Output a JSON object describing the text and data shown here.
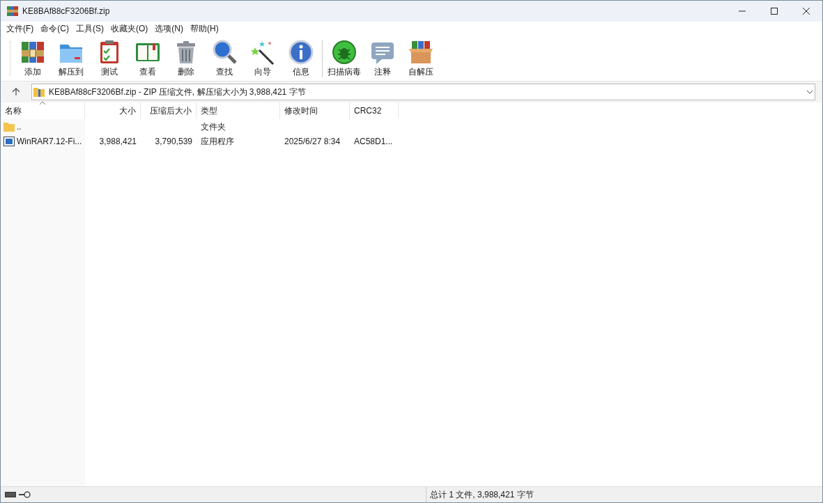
{
  "window": {
    "title": "KE8BAf88cF3206Bf.zip"
  },
  "menu": [
    "文件(F)",
    "命令(C)",
    "工具(S)",
    "收藏夹(O)",
    "选项(N)",
    "帮助(H)"
  ],
  "toolbar": [
    {
      "kind": "add",
      "label": "添加"
    },
    {
      "kind": "extract",
      "label": "解压到"
    },
    {
      "kind": "test",
      "label": "测试"
    },
    {
      "kind": "view",
      "label": "查看"
    },
    {
      "kind": "delete",
      "label": "删除"
    },
    {
      "kind": "find",
      "label": "查找"
    },
    {
      "kind": "wizard",
      "label": "向导"
    },
    {
      "kind": "info",
      "label": "信息"
    },
    {
      "kind": "separator"
    },
    {
      "kind": "scan",
      "label": "扫描病毒"
    },
    {
      "kind": "comment",
      "label": "注释"
    },
    {
      "kind": "sfx",
      "label": "自解压"
    }
  ],
  "path": "KE8BAf88cF3206Bf.zip - ZIP 压缩文件, 解压缩大小为 3,988,421 字节",
  "table": {
    "columns": [
      "名称",
      "大小",
      "压缩后大小",
      "类型",
      "修改时间",
      "CRC32"
    ],
    "rows": [
      {
        "kind": "folder",
        "cells": [
          "..",
          "",
          "",
          "文件夹",
          "",
          ""
        ]
      },
      {
        "kind": "app",
        "cells": [
          "WinRAR7.12-Fi...",
          "3,988,421",
          "3,790,539",
          "应用程序",
          "2025/6/27 8:34",
          "AC58D1..."
        ]
      }
    ]
  },
  "status": "总计 1 文件, 3,988,421 字节"
}
